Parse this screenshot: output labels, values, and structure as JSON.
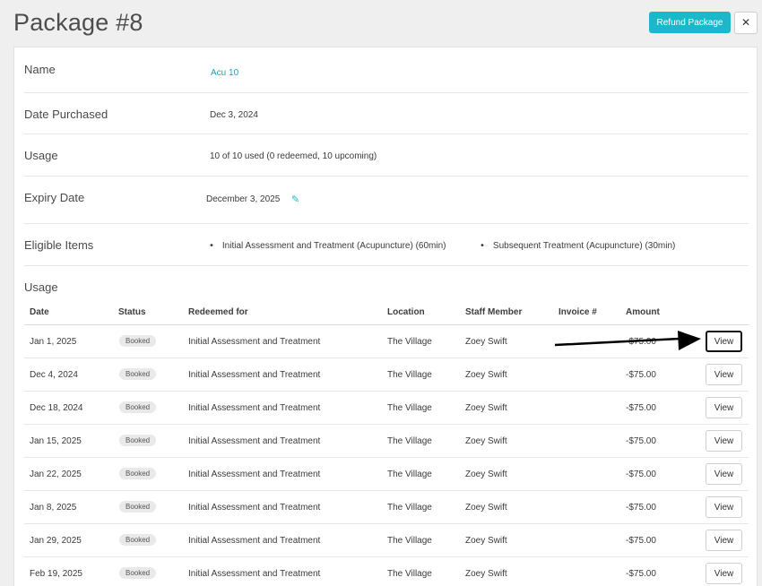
{
  "header": {
    "title": "Package #8",
    "refund_label": "Refund Package",
    "close_label": "✕"
  },
  "details": {
    "name_label": "Name",
    "name_value": "Acu 10",
    "purchased_label": "Date Purchased",
    "purchased_value": "Dec 3, 2024",
    "usage_label": "Usage",
    "usage_value": "10 of 10 used (0 redeemed, 10 upcoming)",
    "expiry_label": "Expiry Date",
    "expiry_value": "December 3, 2025",
    "eligible_label": "Eligible Items",
    "eligible_items": [
      "Initial Assessment and Treatment (Acupuncture) (60min)",
      "Subsequent Treatment (Acupuncture) (30min)"
    ]
  },
  "usage_table": {
    "heading": "Usage",
    "columns": [
      "Date",
      "Status",
      "Redeemed for",
      "Location",
      "Staff Member",
      "Invoice #",
      "Amount"
    ],
    "view_label": "View",
    "rows": [
      {
        "date": "Jan 1, 2025",
        "status": "Booked",
        "redeemed_for": "Initial Assessment and Treatment",
        "location": "The Village",
        "staff": "Zoey Swift",
        "invoice": "",
        "amount": "-$75.00"
      },
      {
        "date": "Dec 4, 2024",
        "status": "Booked",
        "redeemed_for": "Initial Assessment and Treatment",
        "location": "The Village",
        "staff": "Zoey Swift",
        "invoice": "",
        "amount": "-$75.00"
      },
      {
        "date": "Dec 18, 2024",
        "status": "Booked",
        "redeemed_for": "Initial Assessment and Treatment",
        "location": "The Village",
        "staff": "Zoey Swift",
        "invoice": "",
        "amount": "-$75.00"
      },
      {
        "date": "Jan 15, 2025",
        "status": "Booked",
        "redeemed_for": "Initial Assessment and Treatment",
        "location": "The Village",
        "staff": "Zoey Swift",
        "invoice": "",
        "amount": "-$75.00"
      },
      {
        "date": "Jan 22, 2025",
        "status": "Booked",
        "redeemed_for": "Initial Assessment and Treatment",
        "location": "The Village",
        "staff": "Zoey Swift",
        "invoice": "",
        "amount": "-$75.00"
      },
      {
        "date": "Jan 8, 2025",
        "status": "Booked",
        "redeemed_for": "Initial Assessment and Treatment",
        "location": "The Village",
        "staff": "Zoey Swift",
        "invoice": "",
        "amount": "-$75.00"
      },
      {
        "date": "Jan 29, 2025",
        "status": "Booked",
        "redeemed_for": "Initial Assessment and Treatment",
        "location": "The Village",
        "staff": "Zoey Swift",
        "invoice": "",
        "amount": "-$75.00"
      },
      {
        "date": "Feb 19, 2025",
        "status": "Booked",
        "redeemed_for": "Initial Assessment and Treatment",
        "location": "The Village",
        "staff": "Zoey Swift",
        "invoice": "",
        "amount": "-$75.00"
      }
    ]
  },
  "colors": {
    "accent": "#1ab8c8",
    "link": "#1aa6b8",
    "annotation_arrow": "#000000"
  },
  "icons": {
    "edit": "pencil-icon",
    "close": "close-icon"
  }
}
